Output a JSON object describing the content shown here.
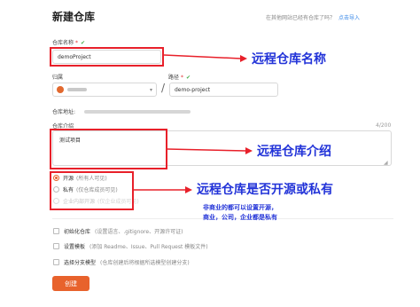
{
  "header": {
    "title": "新建仓库",
    "import_hint": "在其他网站已经有仓库了吗？",
    "import_link": "点击导入"
  },
  "form": {
    "repo_name_label": "仓库名称",
    "required_mark": "*",
    "check_mark": "✔",
    "repo_name_value": "demoProject",
    "owner_label": "归属",
    "path_label": "路径",
    "separator": "/",
    "path_value": "demo-project",
    "repo_url_label": "仓库地址:",
    "desc_label": "仓库介绍",
    "desc_count": "4/200",
    "desc_value": "测试项目",
    "visibility": [
      {
        "label": "开源",
        "hint": "(所有人可见)",
        "checked": true,
        "disabled": false
      },
      {
        "label": "私有",
        "hint": "(仅仓库成员可见)",
        "checked": false,
        "disabled": false
      },
      {
        "label": "企业内部开源",
        "hint": "(仅企业成员可见)",
        "checked": false,
        "disabled": true
      }
    ],
    "options": [
      {
        "label": "初始化仓库",
        "hint": "(设置语言、.gitignore、开源许可证)"
      },
      {
        "label": "设置模板",
        "hint": "(添加 Readme、Issue、Pull Request 模板文件)"
      },
      {
        "label": "选择分支模型",
        "hint": "(仓库创建后将根据所选模型创建分支)"
      }
    ],
    "create_button": "创建"
  },
  "annotations": {
    "name_note": "远程仓库名称",
    "desc_note": "远程仓库介绍",
    "visibility_note": "远程仓库是否开源或私有",
    "hint_line1": "非商业的都可以设置开源，",
    "hint_line2": "商业，公司，企业都是私有",
    "color": "#2233d8",
    "box_color": "#e8202a"
  },
  "colors": {
    "accent": "#e8622c",
    "link": "#3a88e8",
    "success": "#4caf50",
    "required": "#e03232"
  }
}
